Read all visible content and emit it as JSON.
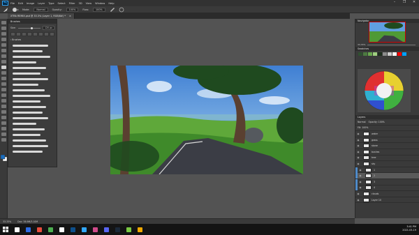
{
  "app": {
    "icon_label": "Ps",
    "menu": [
      "File",
      "Edit",
      "Image",
      "Layer",
      "Type",
      "Select",
      "Filter",
      "3D",
      "View",
      "Window",
      "Help"
    ],
    "window_controls": [
      "–",
      "❐",
      "✕"
    ]
  },
  "options_bar": {
    "mode_label": "Mode:",
    "mode_value": "Normal",
    "opacity_label": "Opacity:",
    "opacity_value": "100%",
    "flow_label": "Flow:",
    "flow_value": "100%"
  },
  "document_tab": {
    "title": "XTRA REMIX.psd @ 33.3% (Layer 1, RGB/8#) *",
    "close": "×"
  },
  "brush_panel": {
    "title": "Brushes",
    "size_label": "Size:",
    "size_value": "120 px",
    "group_label": "› Brushes"
  },
  "canvas": {
    "colors": {
      "sky_top": "#3f7fd3",
      "sky_bottom": "#a9d2f0",
      "hills": "#5fa83a",
      "road": "#3b3d45",
      "trunk": "#5a4030",
      "foliage": "#1f4a1f"
    }
  },
  "navigator": {
    "title": "Navigator",
    "zoom": "33.33%"
  },
  "swatches": {
    "title": "Swatches",
    "colors": [
      "#2f4f2f",
      "#4c7a40",
      "#6aa84f",
      "#9fcf7f",
      "#1e2e1e",
      "#8c8c8c",
      "#c9c9c9",
      "#ffffff",
      "#ff0000",
      "#00a0ff"
    ]
  },
  "color_wheel": {
    "title": "Color",
    "colors": {
      "r": "#e03030",
      "y": "#e8d030",
      "g": "#40b040",
      "c": "#30b0d0",
      "b": "#3050d0",
      "m": "#c040c0"
    }
  },
  "layers_panel": {
    "title": "Layers",
    "blend_mode": "Normal",
    "opacity": "Opacity: 100%",
    "fill": "Fill: 100%",
    "rows": [
      {
        "name": "water",
        "visible": false,
        "selected": false
      },
      {
        "name": "grass",
        "visible": false,
        "selected": false
      },
      {
        "name": "stone",
        "visible": false,
        "selected": false
      },
      {
        "name": "bushes",
        "visible": false,
        "selected": false
      },
      {
        "name": "tree",
        "visible": false,
        "selected": false
      },
      {
        "name": "sky",
        "visible": false,
        "selected": false
      },
      {
        "name": "1",
        "visible": true,
        "selected": false
      },
      {
        "name": "2",
        "visible": true,
        "selected": true
      },
      {
        "name": "3",
        "visible": true,
        "selected": false
      },
      {
        "name": "4",
        "visible": true,
        "selected": false
      },
      {
        "name": "clouds",
        "visible": false,
        "selected": false
      },
      {
        "name": "Layer 10",
        "visible": false,
        "selected": false
      }
    ]
  },
  "status_bar": {
    "zoom": "33.33%",
    "doc": "Doc: 38.9M/3.10M"
  },
  "taskbar": {
    "time": "3:41 PM",
    "date": "2021-03-19",
    "app_colors": [
      "#ffffff",
      "#2d6be4",
      "#e84d3d",
      "#4caf50",
      "#ffffff",
      "#0d4f8b",
      "#31a8ff",
      "#d04a8a",
      "#5865f2",
      "#1b2838",
      "#7ac943",
      "#f2a900"
    ]
  }
}
